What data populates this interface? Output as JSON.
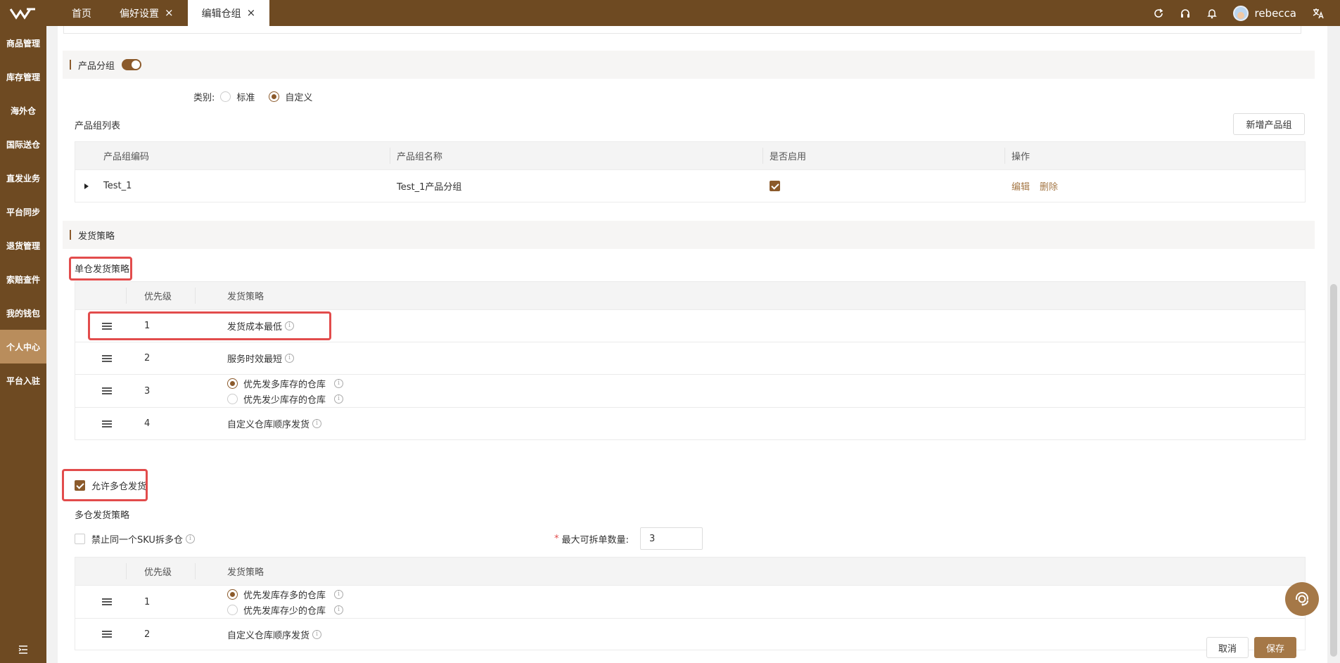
{
  "header": {
    "tabs": [
      {
        "label": "首页",
        "closable": false
      },
      {
        "label": "偏好设置",
        "closable": true
      },
      {
        "label": "编辑仓组",
        "closable": true,
        "active": true
      }
    ],
    "close_glyph": "×",
    "user_name": "rebecca",
    "icons": [
      "refresh-icon",
      "headset-icon",
      "bell-icon",
      "translate-icon"
    ]
  },
  "sidebar": {
    "items": [
      "商品管理",
      "库存管理",
      "海外仓",
      "国际送仓",
      "直发业务",
      "平台同步",
      "退货管理",
      "索赔查件",
      "我的钱包",
      "个人中心",
      "平台入驻"
    ],
    "active_index": 9
  },
  "product_group": {
    "title": "产品分组",
    "toggle_on": true,
    "category_label": "类别:",
    "category_options": [
      "标准",
      "自定义"
    ],
    "category_selected": "自定义",
    "list_title": "产品组列表",
    "add_button": "新增产品组",
    "columns": [
      "产品组编码",
      "产品组名称",
      "是否启用",
      "操作"
    ],
    "rows": [
      {
        "code": "Test_1",
        "name": "Test_1产品分组",
        "enabled": true,
        "actions": [
          "编辑",
          "删除"
        ]
      }
    ]
  },
  "shipping": {
    "title": "发货策略",
    "single_title": "单仓发货策略",
    "columns": [
      "优先级",
      "发货策略"
    ],
    "single_rows": [
      {
        "priority": "1",
        "strategy": "发货成本最低"
      },
      {
        "priority": "2",
        "strategy": "服务时效最短"
      },
      {
        "priority": "3",
        "options": [
          {
            "label": "优先发多库存的仓库",
            "selected": true
          },
          {
            "label": "优先发少库存的仓库",
            "selected": false
          }
        ]
      },
      {
        "priority": "4",
        "strategy": "自定义仓库顺序发货"
      }
    ],
    "allow_multi_label": "允许多仓发货",
    "allow_multi_checked": true,
    "multi_title": "多仓发货策略",
    "forbid_split_label": "禁止同一个SKU拆多仓",
    "forbid_split_checked": false,
    "max_split_required": "*",
    "max_split_label": "最大可拆单数量:",
    "max_split_value": "3",
    "multi_rows": [
      {
        "priority": "1",
        "options": [
          {
            "label": "优先发库存多的仓库",
            "selected": true
          },
          {
            "label": "优先发库存少的仓库",
            "selected": false
          }
        ]
      },
      {
        "priority": "2",
        "strategy": "自定义仓库顺序发货"
      }
    ]
  },
  "footer": {
    "cancel": "取消",
    "save": "保存"
  },
  "colors": {
    "brand": "#6e4a22",
    "accent": "#a57847",
    "highlight": "#e24c4c"
  }
}
